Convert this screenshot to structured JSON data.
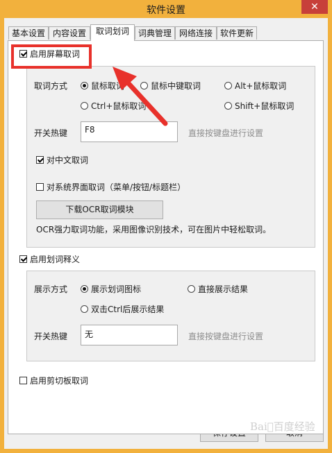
{
  "window": {
    "title": "软件设置",
    "close_glyph": "✕"
  },
  "tabs": [
    {
      "label": "基本设置"
    },
    {
      "label": "内容设置"
    },
    {
      "label": "取词划词",
      "active": true
    },
    {
      "label": "词典管理"
    },
    {
      "label": "网络连接"
    },
    {
      "label": "软件更新"
    }
  ],
  "screen_capture": {
    "enable_label": "启用屏幕取词",
    "enabled": true,
    "mode_label": "取词方式",
    "modes": [
      {
        "label": "鼠标取词",
        "selected": true
      },
      {
        "label": "鼠标中键取词",
        "selected": false
      },
      {
        "label": "Alt+鼠标取词",
        "selected": false
      },
      {
        "label": "Ctrl+鼠标取词",
        "selected": false
      },
      {
        "label": "Shift+鼠标取词",
        "selected": false
      }
    ],
    "hotkey_label": "开关热键",
    "hotkey_value": "F8",
    "hotkey_hint": "直接按键盘进行设置",
    "chinese_label": "对中文取词",
    "chinese_checked": true,
    "system_ui_label": "对系统界面取词（菜单/按钮/标题栏）",
    "system_ui_checked": false,
    "ocr_button": "下载OCR取词模块",
    "ocr_desc": "OCR强力取词功能，采用图像识别技术，可在图片中轻松取词。"
  },
  "selection": {
    "enable_label": "启用划词释义",
    "enabled": true,
    "display_label": "展示方式",
    "display_modes": [
      {
        "label": "展示划词图标",
        "selected": true
      },
      {
        "label": "直接展示结果",
        "selected": false
      },
      {
        "label": "双击Ctrl后展示结果",
        "selected": false
      }
    ],
    "hotkey_label": "开关热键",
    "hotkey_value": "无",
    "hotkey_hint": "直接按键盘进行设置"
  },
  "clipboard": {
    "label": "启用剪切板取词",
    "checked": false
  },
  "buttons": {
    "save": "保存设置",
    "cancel": "取消"
  },
  "watermark": "Bai⃝百度经验",
  "colors": {
    "frame": "#f2b13d",
    "annotation": "#e8312b",
    "close": "#c7403a"
  }
}
